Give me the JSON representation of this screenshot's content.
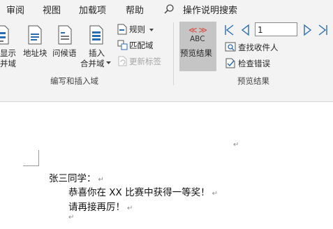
{
  "menu": {
    "tabs": [
      "审阅",
      "视图",
      "加载项",
      "帮助"
    ],
    "search_label": "操作说明搜索"
  },
  "ribbon": {
    "write_insert": {
      "highlight_fields": "显示\n并域",
      "address_block": "地址块",
      "greeting_line": "问候语",
      "insert_merge_field": "插入\n合并域",
      "rules": "规则",
      "match_fields": "匹配域",
      "update_labels": "更新标签",
      "group_label": "编写和插入域"
    },
    "preview": {
      "abc": "ABC",
      "preview_results": "预览结果",
      "record_number": "1",
      "find_recipient": "查找收件人",
      "check_errors": "检查错误",
      "group_label": "预览结果"
    }
  },
  "document": {
    "line1": "张三同学：",
    "line2": "恭喜你在 XX 比赛中获得一等奖！",
    "line3": "请再接再厉！",
    "paragraph_mark": "↵"
  },
  "colors": {
    "accent_blue": "#2b6cb0",
    "preview_red": "#d9453a",
    "ribbon_bg": "#f3f3f3"
  }
}
